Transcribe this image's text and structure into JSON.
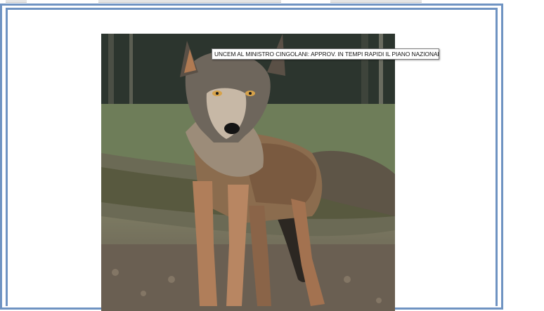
{
  "article": {
    "link_text": "UNCEM AL MINISTRO CINGOLANI: APPROV. IN TEMPI RAPIDI IL PIANO NAZIONALE DI GESTIONE DEL LUPO",
    "image_subject": "grey wolf standing in forest"
  },
  "colors": {
    "frame_border": "#6f93c2",
    "page_background": "#ffffff",
    "caption_background": "#ffffff",
    "caption_border": "#7a7a7a"
  }
}
